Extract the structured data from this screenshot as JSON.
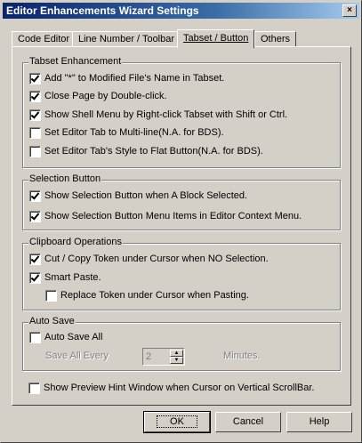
{
  "window": {
    "title": "Editor Enhancements Wizard Settings",
    "close_glyph": "×"
  },
  "tabs": [
    {
      "label": "Code Editor"
    },
    {
      "label": "Line Number / Toolbar"
    },
    {
      "label": "Tabset / Button",
      "active": true
    },
    {
      "label": "Others"
    }
  ],
  "groups": {
    "tabset": {
      "label": "Tabset Enhancement",
      "items": [
        {
          "label": "Add \"*\" to Modified File's Name in Tabset.",
          "checked": true
        },
        {
          "label": "Close Page by Double-click.",
          "checked": true
        },
        {
          "label": "Show Shell Menu by Right-click Tabset with Shift or Ctrl.",
          "checked": true
        },
        {
          "label": "Set Editor Tab to Multi-line(N.A. for BDS).",
          "checked": false
        },
        {
          "label": "Set Editor Tab's Style to Flat Button(N.A. for BDS).",
          "checked": false
        }
      ]
    },
    "selection": {
      "label": "Selection Button",
      "items": [
        {
          "label": "Show Selection Button when A Block Selected.",
          "checked": true
        },
        {
          "label": "Show Selection Button Menu Items in Editor Context Menu.",
          "checked": true
        }
      ]
    },
    "clipboard": {
      "label": "Clipboard Operations",
      "items": [
        {
          "label": "Cut / Copy Token under Cursor when NO Selection.",
          "checked": true
        },
        {
          "label": "Smart Paste.",
          "checked": true
        },
        {
          "label": "Replace Token under Cursor when Pasting.",
          "checked": false
        }
      ]
    },
    "autosave": {
      "label": "Auto Save",
      "enable_label": "Auto Save All",
      "enable_checked": false,
      "interval_prefix": "Save All Every",
      "interval_value": "2",
      "interval_suffix": "Minutes."
    }
  },
  "preview_hint": {
    "label": "Show Preview Hint Window when Cursor on Vertical ScrollBar.",
    "checked": false
  },
  "buttons": {
    "ok": "OK",
    "cancel": "Cancel",
    "help": "Help"
  }
}
